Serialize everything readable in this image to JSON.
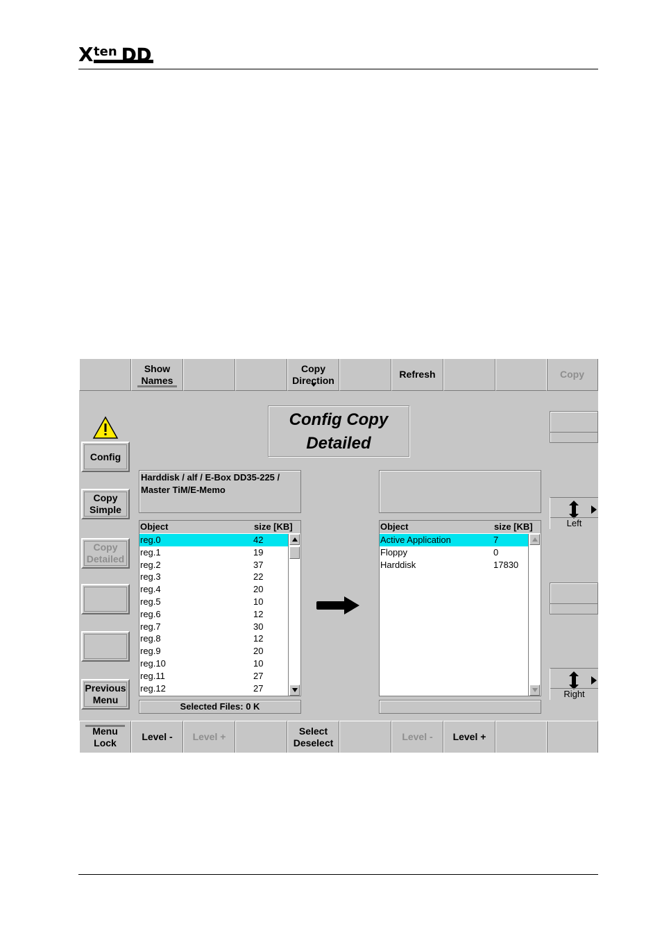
{
  "page": {
    "logo_text": "XtenDD"
  },
  "top_bar": [
    {
      "label": "",
      "state": "normal"
    },
    {
      "label": "Show\nNames",
      "state": "normal"
    },
    {
      "label": "",
      "state": "normal"
    },
    {
      "label": "",
      "state": "normal"
    },
    {
      "label": "Copy\nDirection",
      "state": "normal"
    },
    {
      "label": "",
      "state": "normal"
    },
    {
      "label": "Refresh",
      "state": "normal"
    },
    {
      "label": "",
      "state": "normal"
    },
    {
      "label": "",
      "state": "normal"
    },
    {
      "label": "Copy",
      "state": "disabled"
    }
  ],
  "bottom_bar": [
    {
      "label": "Menu\nLock",
      "state": "normal"
    },
    {
      "label": "Level -",
      "state": "normal"
    },
    {
      "label": "Level +",
      "state": "disabled"
    },
    {
      "label": "",
      "state": "normal"
    },
    {
      "label": "Select\nDeselect",
      "state": "normal"
    },
    {
      "label": "",
      "state": "normal"
    },
    {
      "label": "Level -",
      "state": "disabled"
    },
    {
      "label": "Level +",
      "state": "normal"
    },
    {
      "label": "",
      "state": "normal"
    },
    {
      "label": "",
      "state": "normal"
    }
  ],
  "side_buttons": [
    {
      "label": "Config",
      "state": "normal"
    },
    {
      "label": "Copy\nSimple",
      "state": "normal"
    },
    {
      "label": "Copy\nDetailed",
      "state": "disabled"
    },
    {
      "label": "",
      "state": "normal"
    },
    {
      "label": "",
      "state": "normal"
    },
    {
      "label": "Previous\nMenu",
      "state": "normal"
    }
  ],
  "title": {
    "line1": "Config Copy",
    "line2": "Detailed"
  },
  "source": {
    "path_line1": "Harddisk / alf / E-Box  DD35-225 /",
    "path_line2": "Master TiM/E-Memo",
    "col_object": "Object",
    "col_size": "size [KB]",
    "rows": [
      {
        "object": "reg.0",
        "size": "42",
        "selected": true
      },
      {
        "object": "reg.1",
        "size": "19",
        "selected": false
      },
      {
        "object": "reg.2",
        "size": "37",
        "selected": false
      },
      {
        "object": "reg.3",
        "size": "22",
        "selected": false
      },
      {
        "object": "reg.4",
        "size": "20",
        "selected": false
      },
      {
        "object": "reg.5",
        "size": "10",
        "selected": false
      },
      {
        "object": "reg.6",
        "size": "12",
        "selected": false
      },
      {
        "object": "reg.7",
        "size": "30",
        "selected": false
      },
      {
        "object": "reg.8",
        "size": "12",
        "selected": false
      },
      {
        "object": "reg.9",
        "size": "20",
        "selected": false
      },
      {
        "object": "reg.10",
        "size": "10",
        "selected": false
      },
      {
        "object": "reg.11",
        "size": "27",
        "selected": false
      },
      {
        "object": "reg.12",
        "size": "27",
        "selected": false
      }
    ],
    "status": "Selected Files:  0 K"
  },
  "destination": {
    "col_object": "Object",
    "col_size": "size [KB]",
    "rows": [
      {
        "object": "Active Application",
        "size": "7",
        "selected": true
      },
      {
        "object": "Floppy",
        "size": "0",
        "selected": false
      },
      {
        "object": "Harddisk",
        "size": "17830",
        "selected": false
      }
    ],
    "status": ""
  },
  "right_panel": {
    "left_label": "Left",
    "right_label": "Right"
  },
  "colors": {
    "panel_bg": "#c6c6c6",
    "selection": "#00e4ef",
    "disabled_text": "#8e8e8e"
  }
}
